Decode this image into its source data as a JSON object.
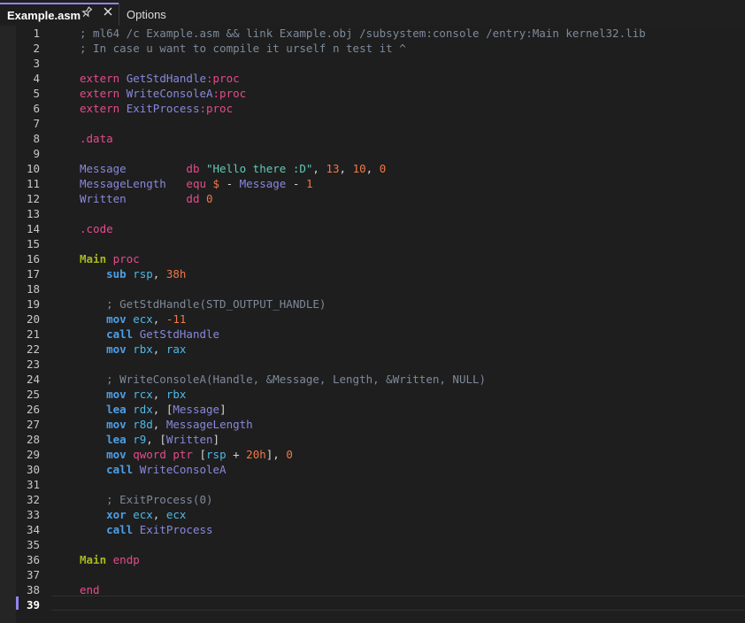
{
  "tabs": {
    "active_label": "Example.asm",
    "pin_icon": "pin-icon",
    "close_icon": "close-icon",
    "options_label": "Options"
  },
  "editor": {
    "current_line": 39,
    "lines": [
      {
        "n": "1",
        "tokens": [
          {
            "t": "; ml64 /c Example.asm && link Example.obj /subsystem:console /entry:Main kernel32.lib",
            "c": "comment"
          }
        ]
      },
      {
        "n": "2",
        "tokens": [
          {
            "t": "; In case u want to compile it urself n test it ^",
            "c": "comment"
          }
        ]
      },
      {
        "n": "3",
        "tokens": []
      },
      {
        "n": "4",
        "tokens": [
          {
            "t": "extern ",
            "c": "directive"
          },
          {
            "t": "GetStdHandle",
            "c": "label"
          },
          {
            "t": ":proc",
            "c": "directive"
          }
        ]
      },
      {
        "n": "5",
        "tokens": [
          {
            "t": "extern ",
            "c": "directive"
          },
          {
            "t": "WriteConsoleA",
            "c": "label"
          },
          {
            "t": ":proc",
            "c": "directive"
          }
        ]
      },
      {
        "n": "6",
        "tokens": [
          {
            "t": "extern ",
            "c": "directive"
          },
          {
            "t": "ExitProcess",
            "c": "label"
          },
          {
            "t": ":proc",
            "c": "directive"
          }
        ]
      },
      {
        "n": "7",
        "tokens": []
      },
      {
        "n": "8",
        "tokens": [
          {
            "t": ".data",
            "c": "directive"
          }
        ]
      },
      {
        "n": "9",
        "tokens": []
      },
      {
        "n": "10",
        "tokens": [
          {
            "t": "Message         ",
            "c": "label"
          },
          {
            "t": "db ",
            "c": "directive"
          },
          {
            "t": "\"Hello there :D\"",
            "c": "string"
          },
          {
            "t": ", ",
            "c": "plain"
          },
          {
            "t": "13",
            "c": "number"
          },
          {
            "t": ", ",
            "c": "plain"
          },
          {
            "t": "10",
            "c": "number"
          },
          {
            "t": ", ",
            "c": "plain"
          },
          {
            "t": "0",
            "c": "number"
          }
        ]
      },
      {
        "n": "11",
        "tokens": [
          {
            "t": "MessageLength   ",
            "c": "label"
          },
          {
            "t": "equ ",
            "c": "directive"
          },
          {
            "t": "$ ",
            "c": "number"
          },
          {
            "t": "- ",
            "c": "plain"
          },
          {
            "t": "Message ",
            "c": "label"
          },
          {
            "t": "- ",
            "c": "plain"
          },
          {
            "t": "1",
            "c": "number"
          }
        ]
      },
      {
        "n": "12",
        "tokens": [
          {
            "t": "Written         ",
            "c": "label"
          },
          {
            "t": "dd ",
            "c": "directive"
          },
          {
            "t": "0",
            "c": "number"
          }
        ]
      },
      {
        "n": "13",
        "tokens": []
      },
      {
        "n": "14",
        "tokens": [
          {
            "t": ".code",
            "c": "directive"
          }
        ]
      },
      {
        "n": "15",
        "tokens": []
      },
      {
        "n": "16",
        "tokens": [
          {
            "t": "Main ",
            "c": "proc"
          },
          {
            "t": "proc",
            "c": "directive"
          }
        ]
      },
      {
        "n": "17",
        "tokens": [
          {
            "t": "    ",
            "c": "plain"
          },
          {
            "t": "sub ",
            "c": "instr"
          },
          {
            "t": "rsp",
            "c": "reg"
          },
          {
            "t": ", ",
            "c": "plain"
          },
          {
            "t": "38h",
            "c": "number"
          }
        ]
      },
      {
        "n": "18",
        "tokens": []
      },
      {
        "n": "19",
        "tokens": [
          {
            "t": "    ; GetStdHandle(STD_OUTPUT_HANDLE)",
            "c": "comment"
          }
        ]
      },
      {
        "n": "20",
        "tokens": [
          {
            "t": "    ",
            "c": "plain"
          },
          {
            "t": "mov ",
            "c": "instr"
          },
          {
            "t": "ecx",
            "c": "reg"
          },
          {
            "t": ", ",
            "c": "plain"
          },
          {
            "t": "-11",
            "c": "number"
          }
        ]
      },
      {
        "n": "21",
        "tokens": [
          {
            "t": "    ",
            "c": "plain"
          },
          {
            "t": "call ",
            "c": "instr"
          },
          {
            "t": "GetStdHandle",
            "c": "label"
          }
        ]
      },
      {
        "n": "22",
        "tokens": [
          {
            "t": "    ",
            "c": "plain"
          },
          {
            "t": "mov ",
            "c": "instr"
          },
          {
            "t": "rbx",
            "c": "reg"
          },
          {
            "t": ", ",
            "c": "plain"
          },
          {
            "t": "rax",
            "c": "reg"
          }
        ]
      },
      {
        "n": "23",
        "tokens": []
      },
      {
        "n": "24",
        "tokens": [
          {
            "t": "    ; WriteConsoleA(Handle, &Message, Length, &Written, NULL)",
            "c": "comment"
          }
        ]
      },
      {
        "n": "25",
        "tokens": [
          {
            "t": "    ",
            "c": "plain"
          },
          {
            "t": "mov ",
            "c": "instr"
          },
          {
            "t": "rcx",
            "c": "reg"
          },
          {
            "t": ", ",
            "c": "plain"
          },
          {
            "t": "rbx",
            "c": "reg"
          }
        ]
      },
      {
        "n": "26",
        "tokens": [
          {
            "t": "    ",
            "c": "plain"
          },
          {
            "t": "lea ",
            "c": "instr"
          },
          {
            "t": "rdx",
            "c": "reg"
          },
          {
            "t": ", [",
            "c": "plain"
          },
          {
            "t": "Message",
            "c": "label"
          },
          {
            "t": "]",
            "c": "plain"
          }
        ]
      },
      {
        "n": "27",
        "tokens": [
          {
            "t": "    ",
            "c": "plain"
          },
          {
            "t": "mov ",
            "c": "instr"
          },
          {
            "t": "r8d",
            "c": "reg"
          },
          {
            "t": ", ",
            "c": "plain"
          },
          {
            "t": "MessageLength",
            "c": "label"
          }
        ]
      },
      {
        "n": "28",
        "tokens": [
          {
            "t": "    ",
            "c": "plain"
          },
          {
            "t": "lea ",
            "c": "instr"
          },
          {
            "t": "r9",
            "c": "reg"
          },
          {
            "t": ", [",
            "c": "plain"
          },
          {
            "t": "Written",
            "c": "label"
          },
          {
            "t": "]",
            "c": "plain"
          }
        ]
      },
      {
        "n": "29",
        "tokens": [
          {
            "t": "    ",
            "c": "plain"
          },
          {
            "t": "mov ",
            "c": "instr"
          },
          {
            "t": "qword ptr ",
            "c": "directive"
          },
          {
            "t": "[",
            "c": "plain"
          },
          {
            "t": "rsp",
            "c": "reg"
          },
          {
            "t": " + ",
            "c": "plain"
          },
          {
            "t": "20h",
            "c": "number"
          },
          {
            "t": "], ",
            "c": "plain"
          },
          {
            "t": "0",
            "c": "number"
          }
        ]
      },
      {
        "n": "30",
        "tokens": [
          {
            "t": "    ",
            "c": "plain"
          },
          {
            "t": "call ",
            "c": "instr"
          },
          {
            "t": "WriteConsoleA",
            "c": "label"
          }
        ]
      },
      {
        "n": "31",
        "tokens": []
      },
      {
        "n": "32",
        "tokens": [
          {
            "t": "    ; ExitProcess(0)",
            "c": "comment"
          }
        ]
      },
      {
        "n": "33",
        "tokens": [
          {
            "t": "    ",
            "c": "plain"
          },
          {
            "t": "xor ",
            "c": "instr"
          },
          {
            "t": "ecx",
            "c": "reg"
          },
          {
            "t": ", ",
            "c": "plain"
          },
          {
            "t": "ecx",
            "c": "reg"
          }
        ]
      },
      {
        "n": "34",
        "tokens": [
          {
            "t": "    ",
            "c": "plain"
          },
          {
            "t": "call ",
            "c": "instr"
          },
          {
            "t": "ExitProcess",
            "c": "label"
          }
        ]
      },
      {
        "n": "35",
        "tokens": []
      },
      {
        "n": "36",
        "tokens": [
          {
            "t": "Main ",
            "c": "proc"
          },
          {
            "t": "endp",
            "c": "directive"
          }
        ]
      },
      {
        "n": "37",
        "tokens": []
      },
      {
        "n": "38",
        "tokens": [
          {
            "t": "end",
            "c": "directive"
          }
        ]
      },
      {
        "n": "39",
        "tokens": []
      }
    ]
  }
}
